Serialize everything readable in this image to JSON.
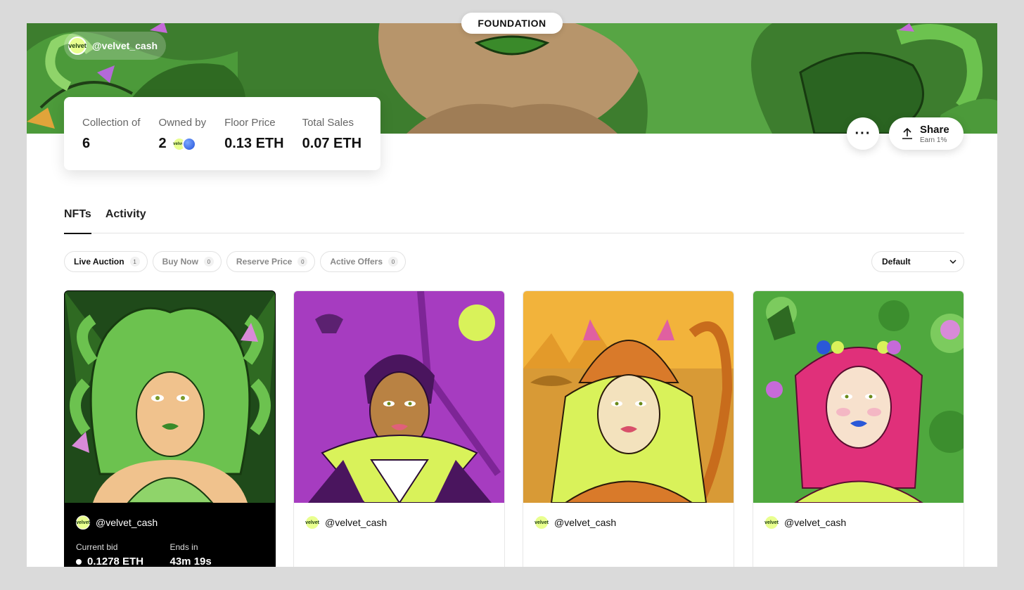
{
  "brand": "FOUNDATION",
  "creator": {
    "handle": "@velvet_cash",
    "logo_text": "velvet"
  },
  "stats": {
    "collection_label": "Collection of",
    "collection_value": "6",
    "owned_label": "Owned by",
    "owned_value": "2",
    "floor_label": "Floor Price",
    "floor_value": "0.13 ETH",
    "sales_label": "Total Sales",
    "sales_value": "0.07 ETH"
  },
  "actions": {
    "more": "···",
    "share": "Share",
    "share_sub": "Earn 1%"
  },
  "tabs": [
    {
      "label": "NFTs"
    },
    {
      "label": "Activity"
    }
  ],
  "filters": [
    {
      "label": "Live Auction",
      "count": "1"
    },
    {
      "label": "Buy Now",
      "count": "0"
    },
    {
      "label": "Reserve Price",
      "count": "0"
    },
    {
      "label": "Active Offers",
      "count": "0"
    }
  ],
  "sort": {
    "value": "Default"
  },
  "cards": [
    {
      "creator": "@velvet_cash",
      "bid_label": "Current bid",
      "bid_value": "0.1278 ETH",
      "ends_label": "Ends in",
      "ends_value": "43m  19s"
    },
    {
      "creator": "@velvet_cash"
    },
    {
      "creator": "@velvet_cash"
    },
    {
      "creator": "@velvet_cash"
    }
  ],
  "colors": {
    "banner_green": "#3f7f2f",
    "leaf_green": "#5bb046",
    "lime": "#d9f25a"
  }
}
